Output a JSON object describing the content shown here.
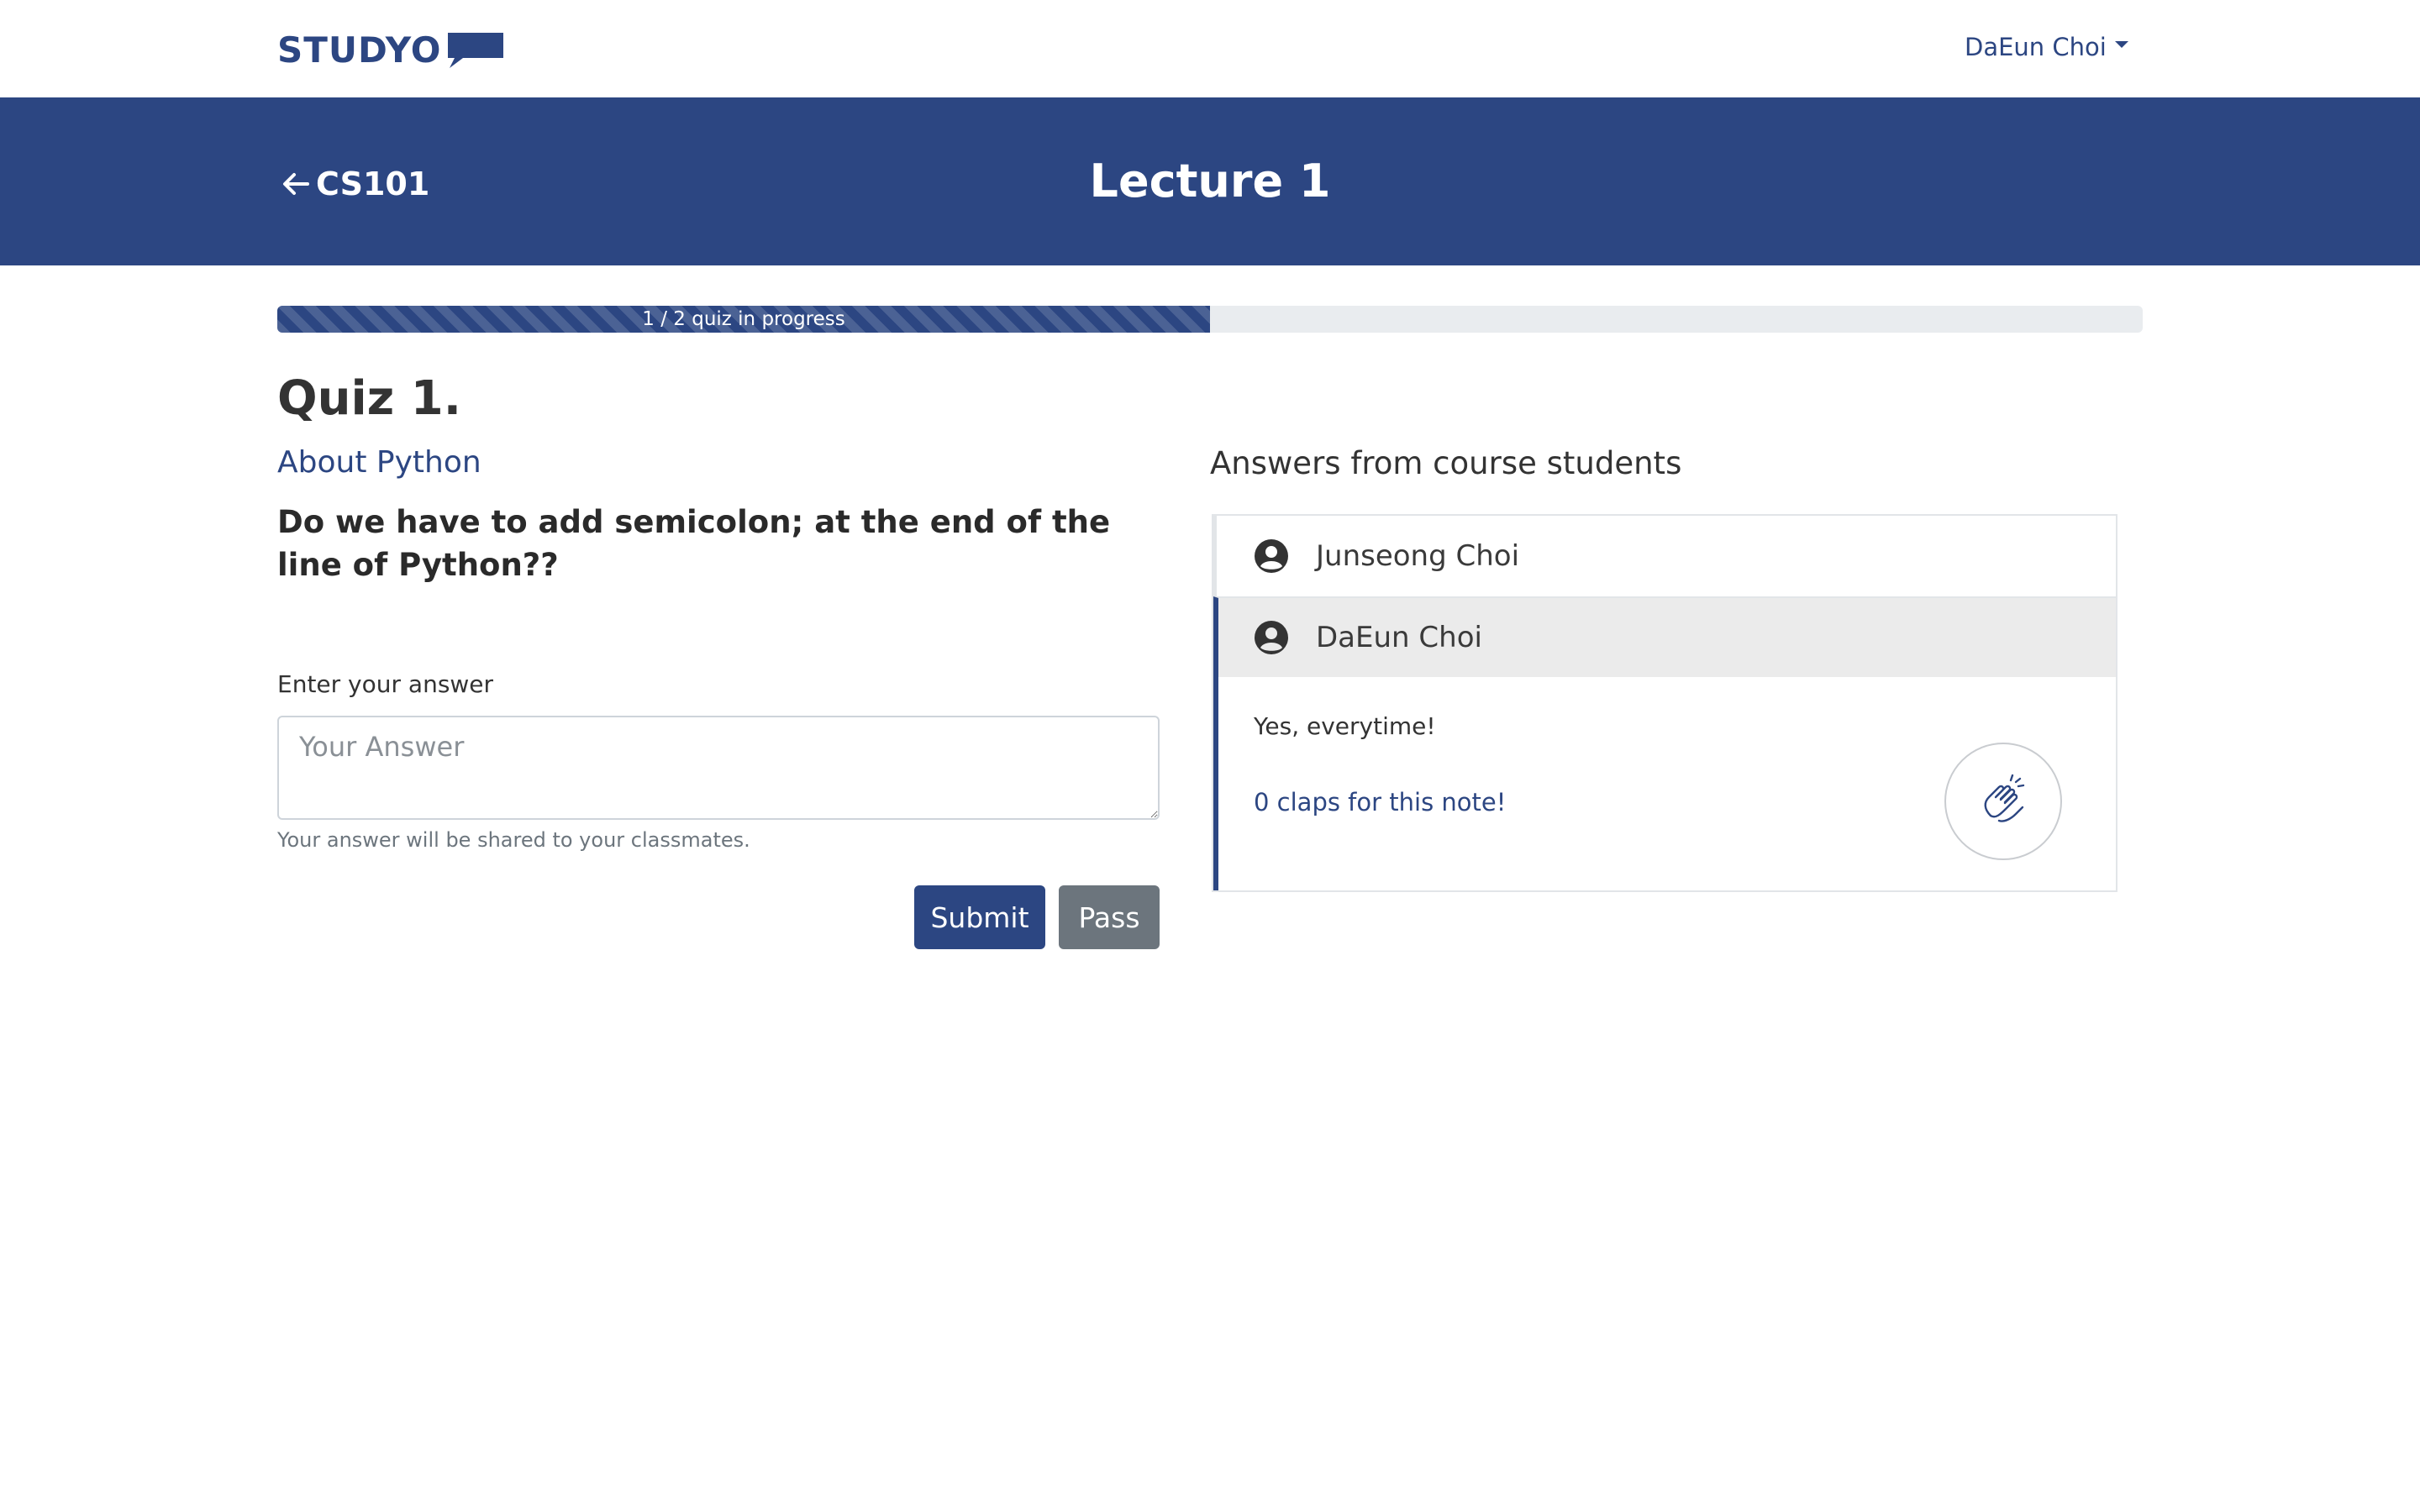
{
  "navbar": {
    "logo_text": "STUDYO",
    "user_name": "DaEun Choi"
  },
  "header": {
    "back_label": "CS101",
    "title": "Lecture 1"
  },
  "progress": {
    "label": "1 / 2 quiz in progress",
    "current": 1,
    "total": 2,
    "fraction": 0.5
  },
  "quiz": {
    "title": "Quiz 1.",
    "topic": "About Python",
    "question": "Do we have to add semicolon; at the end of the line of Python??",
    "answer_label": "Enter your answer",
    "answer_value": "",
    "answer_placeholder": "Your Answer",
    "help_text": "Your answer will be shared to your classmates.",
    "submit_label": "Submit",
    "pass_label": "Pass"
  },
  "answers": {
    "heading": "Answers from course students",
    "items": [
      {
        "name": "Junseong Choi"
      },
      {
        "name": "DaEun Choi"
      }
    ],
    "selected": {
      "text": "Yes, everytime!",
      "claps_text": "0 claps for this note!"
    }
  },
  "colors": {
    "brand": "#2c4682",
    "secondary_button": "#6c757d",
    "selected_row_bg": "#ebebeb"
  },
  "icons": {
    "back": "arrow-left-icon",
    "avatar": "user-circle-icon",
    "clap": "clap-hands-icon",
    "logo": "speech-bubble-icon"
  }
}
